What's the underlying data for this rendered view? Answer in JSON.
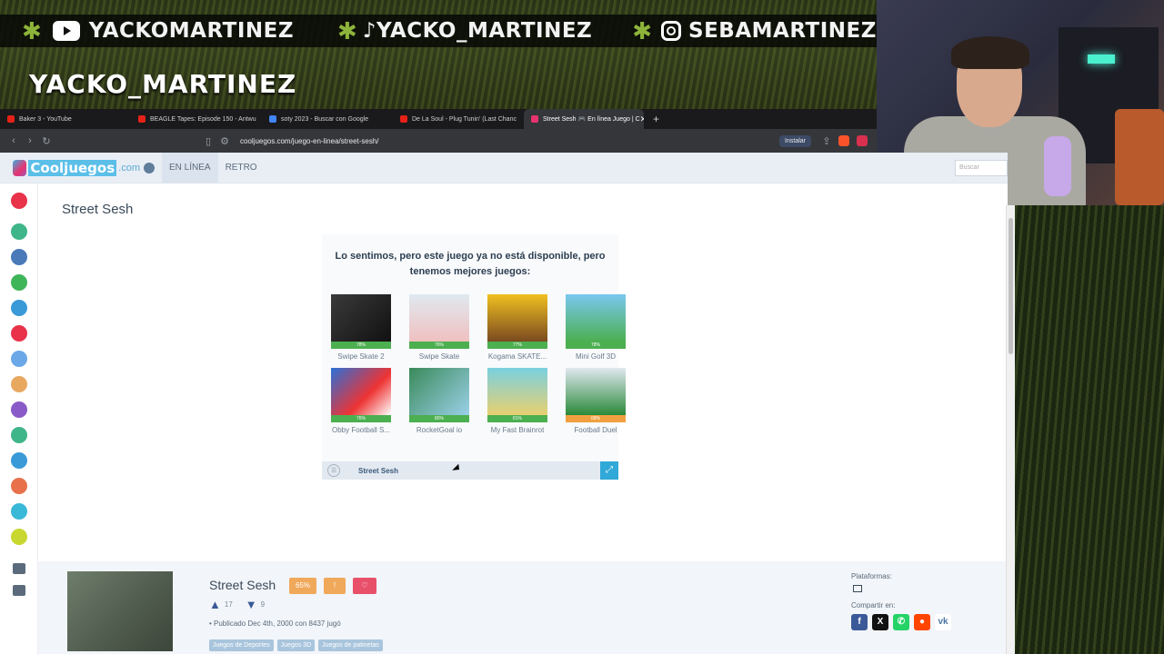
{
  "overlay": {
    "youtube": "YACKOMARTINEZ",
    "tiktok": "♪YACKO_MARTINEZ",
    "instagram": "SEBAMARTINEZA",
    "name": "YACKO_MARTINEZ"
  },
  "browser": {
    "tabs": [
      {
        "label": "Baker 3 - YouTube",
        "color": "#e62117"
      },
      {
        "label": "BEAGLE Tapes: Episode 150 - Antwu",
        "color": "#e62117"
      },
      {
        "label": "soty 2023 - Buscar con Google",
        "color": "#4285f4"
      },
      {
        "label": "De La Soul - Plug Tunin' (Last Chanc",
        "color": "#e62117"
      },
      {
        "label": "Street Sesh 🎮 En línea Juego | C",
        "color": "#e8336f"
      }
    ],
    "url": "cooljuegos.com/juego-en-linea/street-sesh/",
    "install_label": "Instalar"
  },
  "site": {
    "logo": "Cooljuegos",
    "logo_domain": ".com",
    "nav": [
      "EN LÍNEA",
      "RETRO"
    ],
    "search_placeholder": "Buscar"
  },
  "game": {
    "title": "Street Sesh",
    "unavailable_message": "Lo sentimos, pero este juego ya no está disponible, pero tenemos mejores juegos:",
    "recommended": [
      {
        "name": "Swipe Skate 2",
        "rating": "78%",
        "bg": "linear-gradient(135deg,#3a3a3a,#111)"
      },
      {
        "name": "Swipe Skate",
        "rating": "76%",
        "bg": "linear-gradient(180deg,#dfe9f0,#f0c0c0)"
      },
      {
        "name": "Kogama SKATE...",
        "rating": "77%",
        "bg": "linear-gradient(180deg,#f0c020,#7a4a20)"
      },
      {
        "name": "Mini Golf 3D",
        "rating": "78%",
        "bg": "linear-gradient(180deg,#7ac8f0,#4caf50)"
      },
      {
        "name": "Obby Football S...",
        "rating": "76%",
        "bg": "linear-gradient(135deg,#2a70d8,#e33,#fff)"
      },
      {
        "name": "RocketGoal io",
        "rating": "80%",
        "bg": "linear-gradient(135deg,#3a8a5a,#9ad0e8)"
      },
      {
        "name": "My Fast Brainrot",
        "rating": "81%",
        "bg": "linear-gradient(180deg,#7ad0e0,#e8d070)"
      },
      {
        "name": "Football Duel",
        "rating": "68%",
        "bg": "linear-gradient(180deg,#e0e8f0,#2a8a3a)"
      }
    ],
    "player_label": "Street Sesh",
    "info": {
      "name": "Street Sesh",
      "score": "65%",
      "likes": "17",
      "dislikes": "9",
      "published": "• Publicado Dec 4th, 2000 con 8437 jugó",
      "tags": [
        "Juegos de Deportes",
        "Juegos 3D",
        "Juegos de patinetas"
      ],
      "platforms_label": "Plataformas:",
      "share_label": "Compartir en:"
    }
  }
}
